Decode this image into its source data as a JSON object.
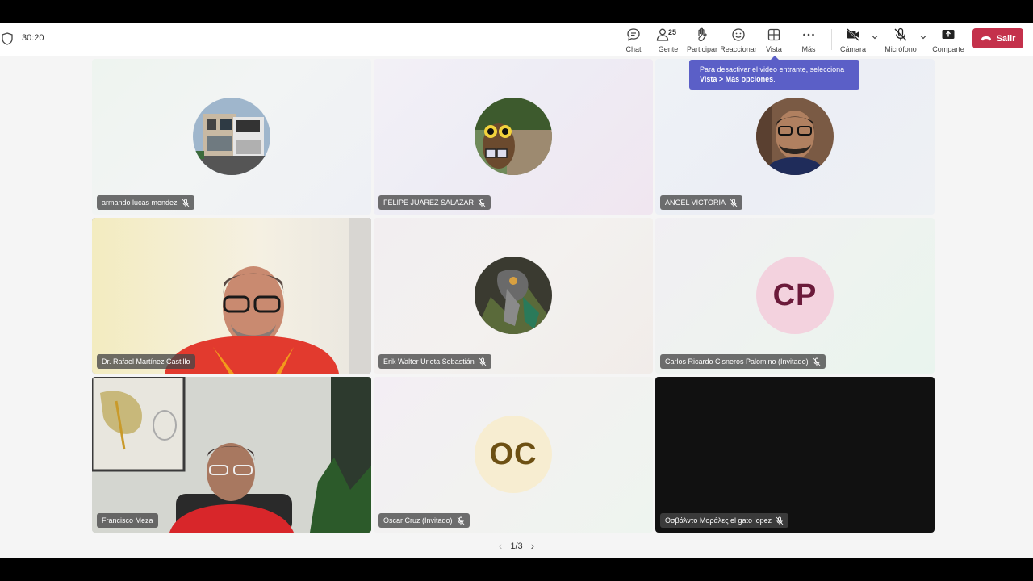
{
  "meeting": {
    "elapsed": "30:20"
  },
  "toolbar": {
    "chat_label": "Chat",
    "people_label": "Gente",
    "people_count": "25",
    "raise_label": "Participar",
    "react_label": "Reaccionar",
    "view_label": "Vista",
    "more_label": "Más",
    "camera_label": "Cámara",
    "mic_label": "Micrófono",
    "share_label": "Comparte",
    "leave_label": "Salir"
  },
  "tooltip": {
    "line1": "Para desactivar el video entrante, selecciona",
    "line2_bold": "Vista > Más opciones",
    "line2_end": "."
  },
  "participants": [
    {
      "name": "armando lucas mendez",
      "muted": true,
      "kind": "photo-house"
    },
    {
      "name": "FELIPE JUAREZ SALAZAR",
      "muted": true,
      "kind": "photo-owl"
    },
    {
      "name": "ANGEL VICTORIA",
      "muted": true,
      "kind": "photo-man"
    },
    {
      "name": "Dr. Rafael Martínez Castillo",
      "muted": false,
      "kind": "video",
      "active": true
    },
    {
      "name": "Erik Walter Urieta Sebastián",
      "muted": true,
      "kind": "photo-art"
    },
    {
      "name": "Carlos Ricardo Cisneros Palomino (Invitado)",
      "muted": true,
      "kind": "initials",
      "initials": "CP"
    },
    {
      "name": "Francisco Meza",
      "muted": false,
      "kind": "video"
    },
    {
      "name": "Oscar Cruz (Invitado)",
      "muted": true,
      "kind": "initials",
      "initials": "OC"
    },
    {
      "name": "Οσβάλντο Μοράλες el gato lopez",
      "muted": true,
      "kind": "video-off"
    }
  ],
  "pagination": {
    "label": "1/3"
  },
  "colors": {
    "accent": "#5b5fc7",
    "leave": "#c4314b"
  }
}
